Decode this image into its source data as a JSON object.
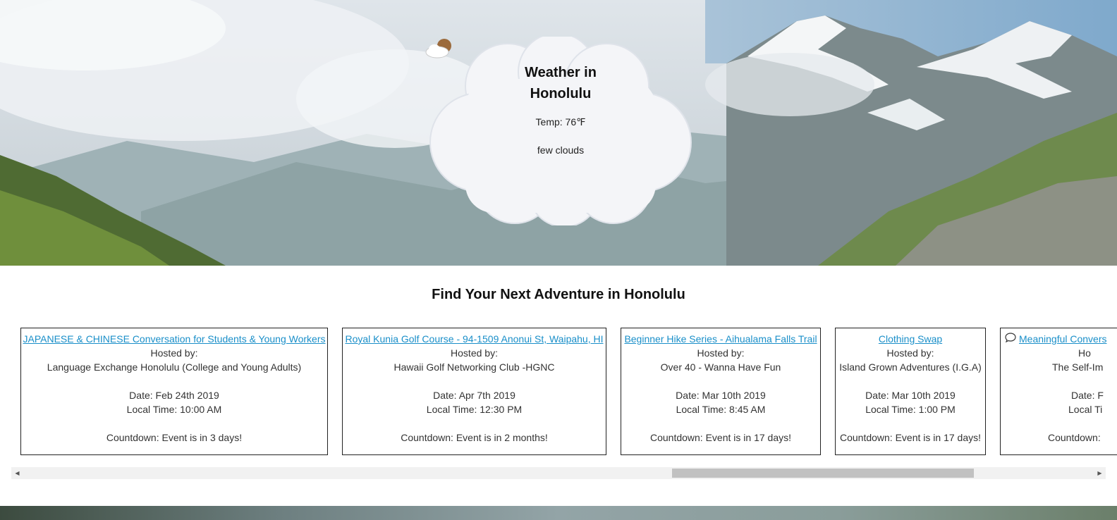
{
  "weather": {
    "title_line1": "Weather in",
    "title_line2": "Honolulu",
    "temp": "Temp: 76℉",
    "description": "few clouds",
    "icon": "few-clouds-icon"
  },
  "adventures": {
    "heading": "Find Your Next Adventure in Honolulu",
    "events": [
      {
        "title": "JAPANESE & CHINESE Conversation for Students & Young Workers",
        "hosted_label": "Hosted by:",
        "host": "Language Exchange Honolulu (College and Young Adults)",
        "date": "Date: Feb 24th 2019",
        "time": "Local Time: 10:00 AM",
        "countdown": "Countdown: Event is in 3 days!"
      },
      {
        "title": "Royal Kunia Golf Course - 94-1509 Anonui St, Waipahu, HI",
        "hosted_label": "Hosted by:",
        "host": "Hawaii Golf Networking Club -HGNC",
        "date": "Date: Apr 7th 2019",
        "time": "Local Time: 12:30 PM",
        "countdown": "Countdown: Event is in 2 months!"
      },
      {
        "title": "Beginner Hike Series - Aihualama Falls Trail",
        "hosted_label": "Hosted by:",
        "host": "Over 40 - Wanna Have Fun",
        "date": "Date: Mar 10th 2019",
        "time": "Local Time: 8:45 AM",
        "countdown": "Countdown: Event is in 17 days!"
      },
      {
        "title": "Clothing Swap",
        "hosted_label": "Hosted by:",
        "host": "Island Grown Adventures (I.G.A)",
        "date": "Date: Mar 10th 2019",
        "time": "Local Time: 1:00 PM",
        "countdown": "Countdown: Event is in 17 days!"
      },
      {
        "title": "Meaningful Convers",
        "hosted_label": "Ho",
        "host": "The Self-Im",
        "date": "Date: F",
        "time": "Local Ti",
        "countdown": "Countdown: "
      }
    ]
  },
  "colors": {
    "link": "#1a8fc9",
    "border": "#222222",
    "scroll_track": "#f1f1f1",
    "scroll_thumb": "#c1c1c1"
  },
  "scrollbar": {
    "left_arrow": "◀",
    "right_arrow": "▶"
  }
}
